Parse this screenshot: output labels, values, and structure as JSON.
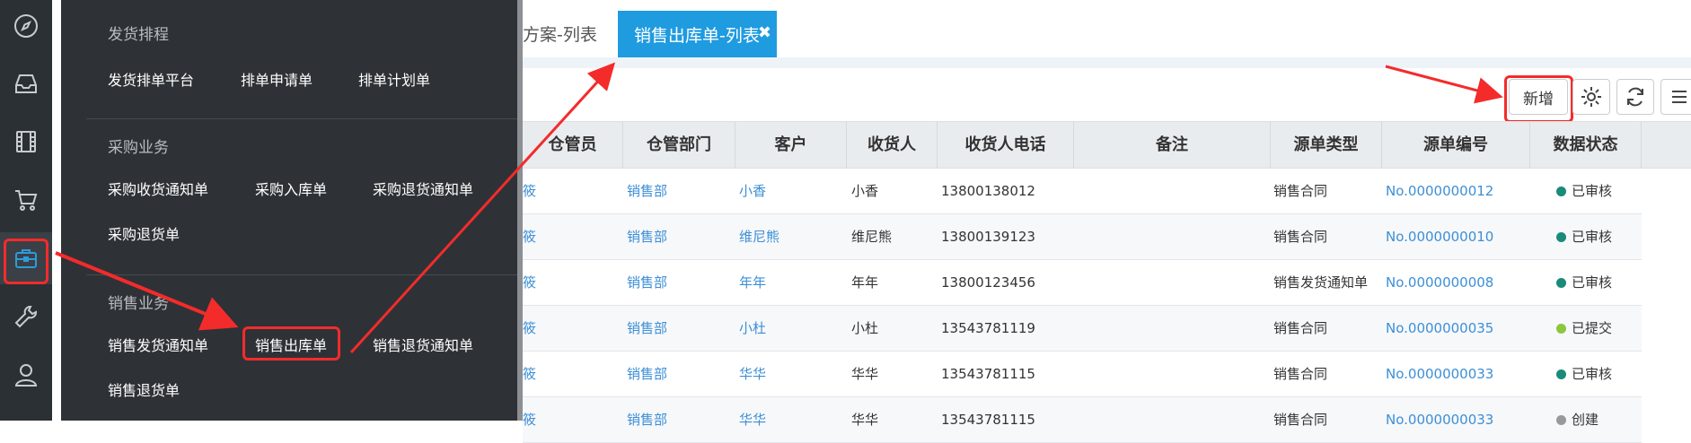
{
  "rail": {
    "items": [
      {
        "icon": "compass-icon"
      },
      {
        "icon": "inbox-icon"
      },
      {
        "icon": "film-icon"
      },
      {
        "icon": "cart-icon"
      },
      {
        "icon": "briefcase-icon",
        "active": true
      },
      {
        "icon": "wrench-icon"
      },
      {
        "icon": "user-icon"
      }
    ]
  },
  "menu": {
    "groups": [
      {
        "title": "发货排程",
        "items": [
          "发货排单平台",
          "排单申请单",
          "排单计划单"
        ]
      },
      {
        "title": "采购业务",
        "items": [
          "采购收货通知单",
          "采购入库单",
          "采购退货通知单",
          "采购退货单"
        ]
      },
      {
        "title": "销售业务",
        "items": [
          "销售发货通知单",
          "销售出库单",
          "销售退货通知单",
          "销售退货单"
        ]
      }
    ]
  },
  "tabs": {
    "previous": "方案-列表",
    "active": "销售出库单-列表",
    "close": "✖"
  },
  "toolbar": {
    "new_label": "新增"
  },
  "table": {
    "columns": [
      "仓管员",
      "仓管部门",
      "客户",
      "收货人",
      "收货人电话",
      "备注",
      "源单类型",
      "源单编号",
      "数据状态"
    ],
    "rows": [
      {
        "keeper": "筱",
        "dept": "销售部",
        "customer": "小香",
        "receiver": "小香",
        "phone": "13800138012",
        "note": "",
        "src_type": "销售合同",
        "src_no": "No.0000000012",
        "status": "已审核",
        "status_color": "#1a8a7a"
      },
      {
        "keeper": "筱",
        "dept": "销售部",
        "customer": "维尼熊",
        "receiver": "维尼熊",
        "phone": "13800139123",
        "note": "",
        "src_type": "销售合同",
        "src_no": "No.0000000010",
        "status": "已审核",
        "status_color": "#1a8a7a"
      },
      {
        "keeper": "筱",
        "dept": "销售部",
        "customer": "年年",
        "receiver": "年年",
        "phone": "13800123456",
        "note": "",
        "src_type": "销售发货通知单",
        "src_no": "No.0000000008",
        "status": "已审核",
        "status_color": "#1a8a7a"
      },
      {
        "keeper": "筱",
        "dept": "销售部",
        "customer": "小杜",
        "receiver": "小杜",
        "phone": "13543781119",
        "note": "",
        "src_type": "销售合同",
        "src_no": "No.0000000035",
        "status": "已提交",
        "status_color": "#8cc63e"
      },
      {
        "keeper": "筱",
        "dept": "销售部",
        "customer": "华华",
        "receiver": "华华",
        "phone": "13543781115",
        "note": "",
        "src_type": "销售合同",
        "src_no": "No.0000000033",
        "status": "已审核",
        "status_color": "#1a8a7a"
      },
      {
        "keeper": "筱",
        "dept": "销售部",
        "customer": "华华",
        "receiver": "华华",
        "phone": "13543781115",
        "note": "",
        "src_type": "销售合同",
        "src_no": "No.0000000033",
        "status": "创建",
        "status_color": "#999999"
      }
    ]
  },
  "colors": {
    "accent": "#1f9be0",
    "annotation": "#f42b2b",
    "rail_bg": "#2b3035",
    "menu_bg": "#2e3236"
  }
}
